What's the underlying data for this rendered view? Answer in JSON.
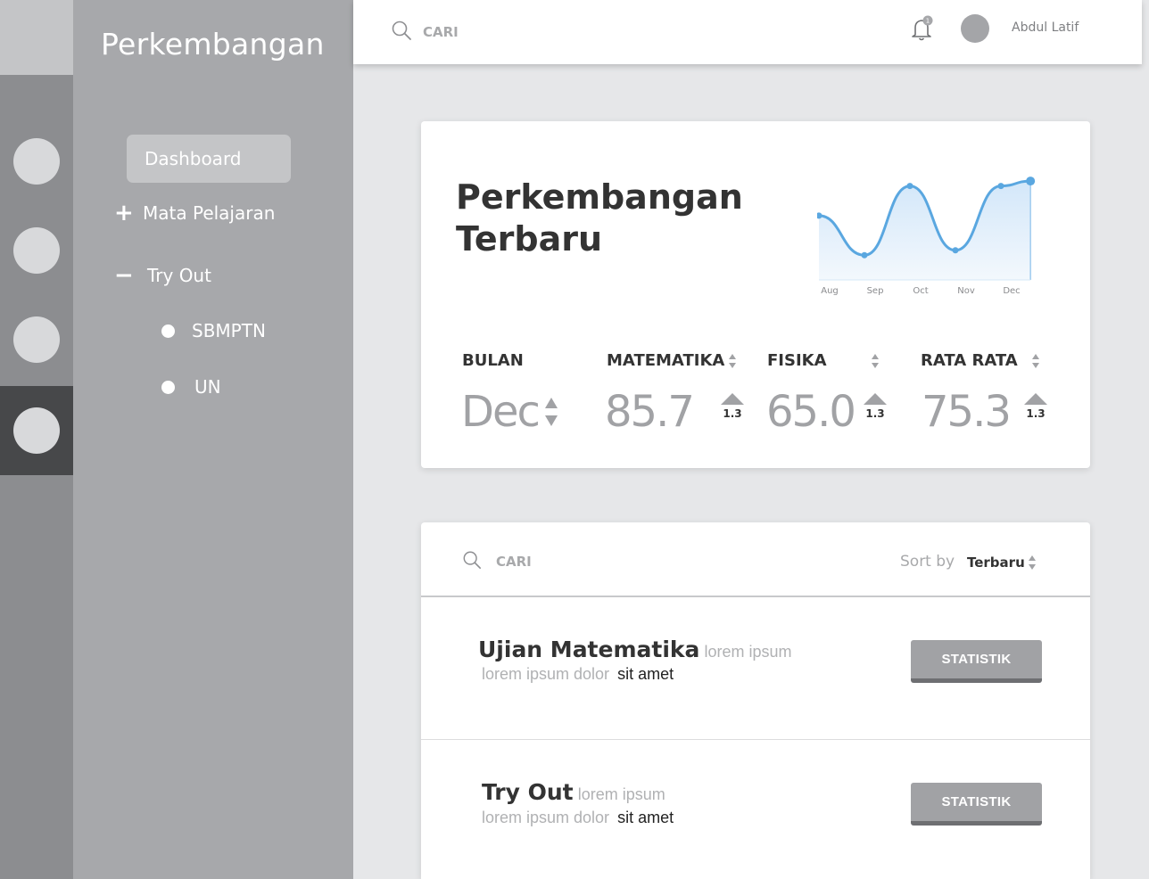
{
  "sidebar": {
    "brand": "Perkembangan",
    "nav": {
      "dashboard": "Dashboard",
      "mata_pelajaran": "Mata Pelajaran",
      "mata_pelajaran_sign": "+",
      "try_out": "Try Out",
      "try_out_sign": "−",
      "children": [
        "SBMPTN",
        "UN"
      ]
    },
    "rail_active_index": 3
  },
  "topbar": {
    "search_placeholder": "CARI",
    "notification_count": "1",
    "username": "Abdul Latif"
  },
  "stats_card": {
    "title_line1": "Perkembangan",
    "title_line2": "Terbaru",
    "columns": {
      "bulan": {
        "label": "BULAN",
        "value": "Dec"
      },
      "matematika": {
        "label": "MATEMATIKA",
        "value": "85.7",
        "delta": "1.3"
      },
      "fisika": {
        "label": "FISIKA",
        "value": "65.0",
        "delta": "1.3"
      },
      "rata_rata": {
        "label": "RATA RATA",
        "value": "75.3",
        "delta": "1.3"
      }
    }
  },
  "chart_data": {
    "type": "area",
    "categories": [
      "Aug",
      "Sep",
      "Oct",
      "Nov",
      "Dec"
    ],
    "values": [
      0.65,
      0.25,
      0.95,
      0.3,
      0.95,
      1.0
    ],
    "x_positions": [
      0,
      1,
      2,
      3,
      4,
      4.65
    ],
    "ylim": [
      0,
      1.1
    ],
    "grid": false,
    "line_color": "#5aa7e0",
    "fill_color": "#dcecfa"
  },
  "list_card": {
    "search_placeholder": "CARI",
    "sort_label": "Sort by",
    "sort_value": "Terbaru",
    "items": [
      {
        "title": "Ujian Matematika",
        "subtitle_muted": "lorem ipsum",
        "line2_muted": "lorem ipsum dolor",
        "line2_dark": "sit amet",
        "button": "STATISTIK"
      },
      {
        "title": "Try Out",
        "subtitle_muted": "lorem ipsum",
        "line2_muted": "lorem ipsum dolor",
        "line2_dark": "sit amet",
        "button": "STATISTIK"
      }
    ]
  }
}
